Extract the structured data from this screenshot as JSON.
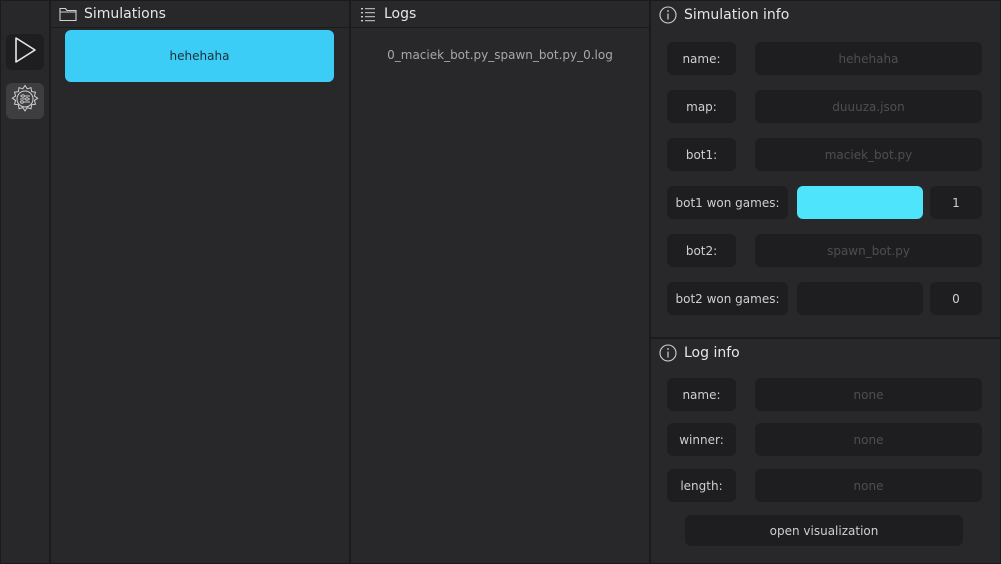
{
  "toolbar": {
    "items": [
      {
        "icon": "play-icon"
      },
      {
        "icon": "settings-icon"
      }
    ]
  },
  "simulations": {
    "title": "Simulations",
    "icon": "folder-icon",
    "items": [
      "hehehaha"
    ],
    "selected_color": "#3ccdf6"
  },
  "logs": {
    "title": "Logs",
    "icon": "list-icon",
    "items": [
      "0_maciek_bot.py_spawn_bot.py_0.log"
    ]
  },
  "simulation_info": {
    "title": "Simulation info",
    "icon": "info-icon",
    "name_label": "name:",
    "name_value": "hehehaha",
    "map_label": "map:",
    "map_value": "duuuza.json",
    "bot1_label": "bot1:",
    "bot1_value": "maciek_bot.py",
    "bot1_won_label": "bot1 won games:",
    "bot1_won_count": "1",
    "bot1_won_fraction": 1.0,
    "bot2_label": "bot2:",
    "bot2_value": "spawn_bot.py",
    "bot2_won_label": "bot2 won games:",
    "bot2_won_count": "0",
    "bot2_won_fraction": 0.0,
    "bar_color": "#4ee5fc"
  },
  "log_info": {
    "title": "Log info",
    "icon": "info-icon",
    "name_label": "name:",
    "name_value": "none",
    "winner_label": "winner:",
    "winner_value": "none",
    "length_label": "length:",
    "length_value": "none",
    "open_button": "open visualization"
  }
}
